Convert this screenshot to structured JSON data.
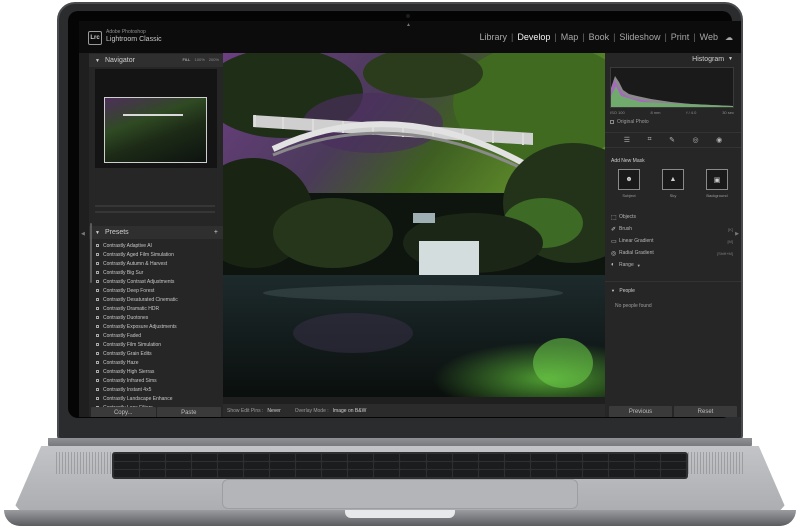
{
  "app": {
    "vendor": "Adobe Photoshop",
    "name": "Lightroom Classic",
    "logo": "Lrc"
  },
  "modules": [
    "Library",
    "Develop",
    "Map",
    "Book",
    "Slideshow",
    "Print",
    "Web"
  ],
  "active_module": "Develop",
  "left_panel": {
    "navigator_title": "Navigator",
    "zoom_levels": [
      "FILL",
      "100%",
      "200%"
    ],
    "presets_title": "Presets",
    "presets": [
      "Contrastly Adaptive AI",
      "Contrastly Aged Film Simulation",
      "Contrastly Autumn & Harvest",
      "Contrastly Big Sur",
      "Contrastly Contrast Adjustments",
      "Contrastly Deep Forest",
      "Contrastly Desaturated Cinematic",
      "Contrastly Dramatic HDR",
      "Contrastly Duotones",
      "Contrastly Exposure Adjustments",
      "Contrastly Faded",
      "Contrastly Film Simulation",
      "Contrastly Grain Edits",
      "Contrastly Haze",
      "Contrastly High Sierras",
      "Contrastly Infrared Sims",
      "Contrastly Instant 4x5",
      "Contrastly Landscape Enhance",
      "Contrastly Lens Filters"
    ],
    "copy_label": "Copy...",
    "paste_label": "Paste"
  },
  "toolbar": {
    "edit_pins_label": "Show Edit Pins :",
    "edit_pins_value": "Never",
    "overlay_label": "Overlay Mode :",
    "overlay_value": "Image on B&W"
  },
  "right_panel": {
    "histogram_title": "Histogram",
    "iso": "ISO 100",
    "focal": "8 mm",
    "aperture": "f / 4.0",
    "shutter": "30 sec",
    "original_photo_label": "Original Photo",
    "add_mask_title": "Add New Mask",
    "mask_buttons": [
      "Subject",
      "Sky",
      "Background"
    ],
    "mask_options": [
      {
        "label": "Objects",
        "shortcut": ""
      },
      {
        "label": "Brush",
        "shortcut": "[K]"
      },
      {
        "label": "Linear Gradient",
        "shortcut": "[M]"
      },
      {
        "label": "Radial Gradient",
        "shortcut": "[Shift+M]"
      },
      {
        "label": "Range",
        "shortcut": ""
      }
    ],
    "people_title": "People",
    "people_empty": "No people found",
    "previous_label": "Previous",
    "reset_label": "Reset"
  },
  "colors": {
    "panel_bg": "#262626",
    "topbar_bg": "#0c0c0c",
    "active_module_text": "#f2f2f2"
  }
}
